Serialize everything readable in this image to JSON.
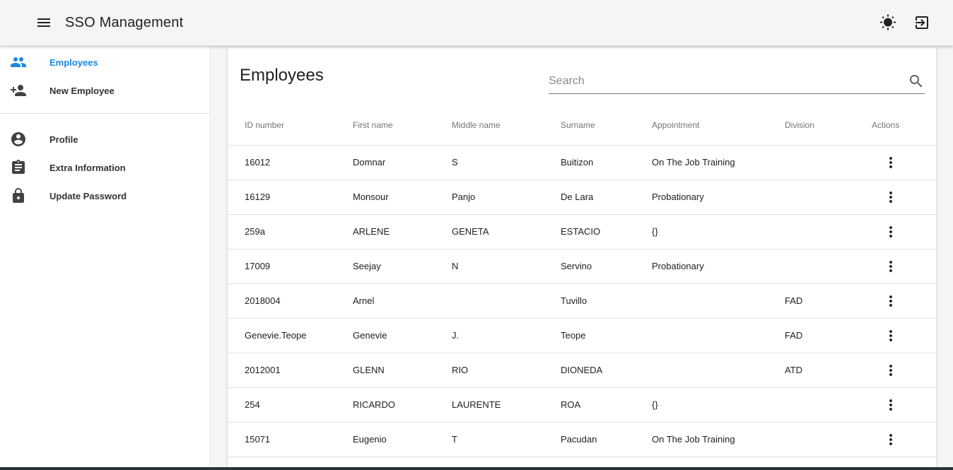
{
  "app": {
    "title": "SSO Management",
    "icons": {
      "menu": "menu-icon",
      "theme": "brightness-icon",
      "logout": "logout-icon"
    }
  },
  "sidebar": {
    "items": [
      {
        "label": "Employees",
        "icon": "people-icon",
        "active": true
      },
      {
        "label": "New Employee",
        "icon": "person-add-icon",
        "active": false
      }
    ],
    "secondary_items": [
      {
        "label": "Profile",
        "icon": "account-circle-icon"
      },
      {
        "label": "Extra Information",
        "icon": "assignment-icon"
      },
      {
        "label": "Update Password",
        "icon": "lock-icon"
      }
    ]
  },
  "main": {
    "title": "Employees",
    "search": {
      "placeholder": "Search",
      "value": ""
    },
    "table": {
      "columns": [
        "ID number",
        "First name",
        "Middle name",
        "Surname",
        "Appointment",
        "Division",
        "Actions"
      ],
      "rows": [
        [
          "16012",
          "Domnar",
          "S",
          "Buitizon",
          "On The Job Training",
          ""
        ],
        [
          "16129",
          "Monsour",
          "Panjo",
          "De Lara",
          "Probationary",
          ""
        ],
        [
          "259a",
          "ARLENE",
          "GENETA",
          "ESTACIO",
          "{}",
          ""
        ],
        [
          "17009",
          "Seejay",
          "N",
          "Servino",
          "Probationary",
          ""
        ],
        [
          "2018004",
          "Arnel",
          "",
          "Tuvillo",
          "",
          "FAD"
        ],
        [
          "Genevie.Teope",
          "Genevie",
          "J.",
          "Teope",
          "",
          "FAD"
        ],
        [
          "2012001",
          "GLENN",
          "RIO",
          "DIONEDA",
          "",
          "ATD"
        ],
        [
          "254",
          "RICARDO",
          "LAURENTE",
          "ROA",
          "{}",
          ""
        ],
        [
          "15071",
          "Eugenio",
          "T",
          "Pacudan",
          "On The Job Training",
          ""
        ]
      ]
    }
  },
  "colors": {
    "accent": "#1e88e5",
    "appbar": "#f5f5f5",
    "icon": "#424242"
  }
}
